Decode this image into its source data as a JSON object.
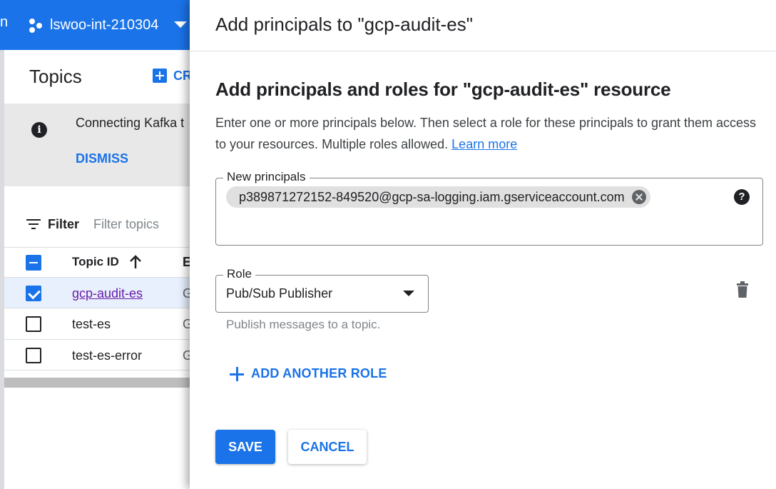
{
  "background": {
    "header": {
      "edge_text": "n",
      "project_icon": "project-hexagon-icon",
      "project_name": "lswoo-int-210304",
      "dropdown_icon": "caret-down-icon"
    },
    "page_title": "Topics",
    "create_label": "CR",
    "banner": {
      "icon": "info-icon",
      "text": "Connecting Kafka t",
      "dismiss_label": "DISMISS"
    },
    "filter": {
      "label": "Filter",
      "placeholder": "Filter topics"
    },
    "table": {
      "columns": [
        "Topic ID",
        "E"
      ],
      "rows": [
        {
          "topic_id": "gcp-audit-es",
          "e": "G",
          "checked": true
        },
        {
          "topic_id": "test-es",
          "e": "G",
          "checked": false
        },
        {
          "topic_id": "test-es-error",
          "e": "G",
          "checked": false
        }
      ]
    }
  },
  "panel": {
    "title": "Add principals to \"gcp-audit-es\"",
    "section_title": "Add principals and roles for \"gcp-audit-es\" resource",
    "description": "Enter one or more principals below. Then select a role for these principals to grant them access to your resources. Multiple roles allowed.",
    "learn_more": "Learn more",
    "principals_label": "New principals",
    "principal_chip": "p389871272152-849520@gcp-sa-logging.iam.gserviceaccount.com",
    "role_label": "Role",
    "role_value": "Pub/Sub Publisher",
    "role_helper": "Publish messages to a topic.",
    "add_role_label": "ADD ANOTHER ROLE",
    "save_label": "SAVE",
    "cancel_label": "CANCEL"
  },
  "colors": {
    "accent": "#1a73e8",
    "visited_link": "#681da8"
  }
}
